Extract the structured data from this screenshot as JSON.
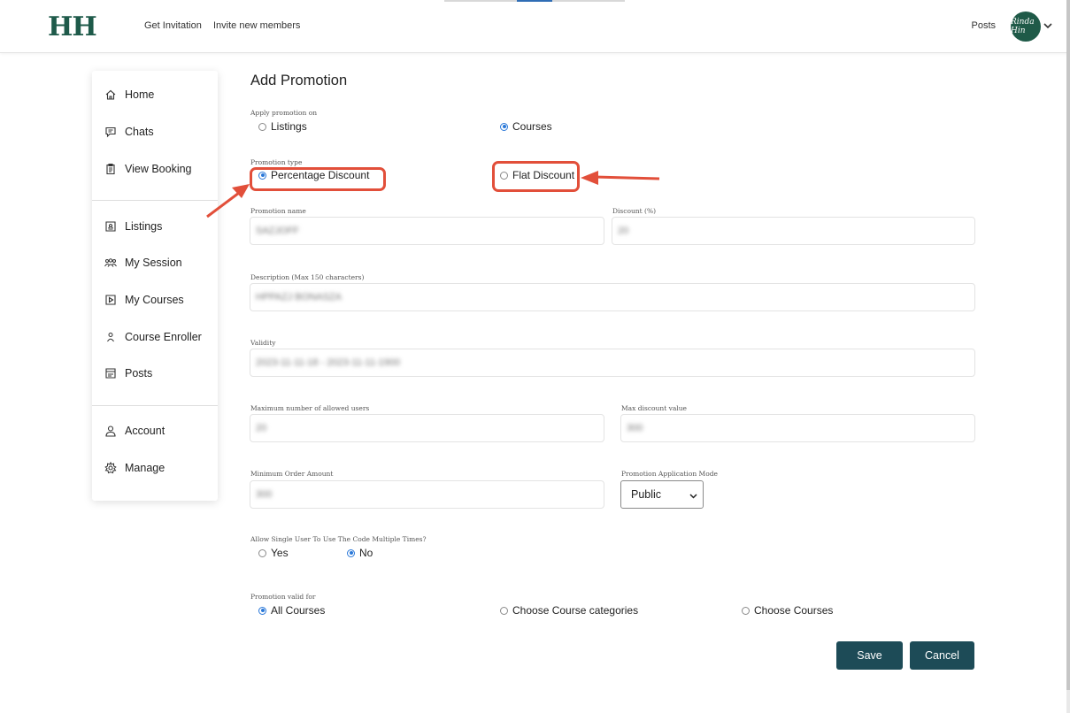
{
  "header": {
    "logo": "HH",
    "nav_links": [
      "Get Invitation",
      "Invite new members"
    ],
    "posts_link": "Posts",
    "avatar_text": "Rinda Hin"
  },
  "sidebar": {
    "items": [
      {
        "label": "Home",
        "icon": "home-icon"
      },
      {
        "label": "Chats",
        "icon": "chat-icon"
      },
      {
        "label": "View Booking",
        "icon": "clipboard-icon"
      },
      {
        "label": "Listings",
        "icon": "listing-icon"
      },
      {
        "label": "My Session",
        "icon": "group-icon"
      },
      {
        "label": "My Courses",
        "icon": "play-icon"
      },
      {
        "label": "Course Enroller",
        "icon": "user-icon"
      },
      {
        "label": "Posts",
        "icon": "posts-icon"
      },
      {
        "label": "Account",
        "icon": "person-icon"
      },
      {
        "label": "Manage",
        "icon": "gear-icon"
      }
    ]
  },
  "form": {
    "title": "Add Promotion",
    "apply_on": {
      "label": "Apply promotion on",
      "options": [
        "Listings",
        "Courses"
      ],
      "selected": "Courses"
    },
    "promotion_type": {
      "label": "Promotion type",
      "options": [
        "Percentage Discount",
        "Flat Discount"
      ],
      "selected": "Percentage Discount"
    },
    "promotion_name": {
      "label": "Promotion name",
      "value": "SAZJOFF"
    },
    "discount": {
      "label": "Discount (%)",
      "value": "20"
    },
    "description": {
      "label": "Description (Max 150 characters)",
      "value": "HPPAZJ BONASZA"
    },
    "validity": {
      "label": "Validity",
      "value": "2023-11-11-18 - 2023-11-11-1900"
    },
    "max_users": {
      "label": "Maximum number of allowed users",
      "value": "20"
    },
    "max_discount": {
      "label": "Max discount value",
      "value": "300"
    },
    "min_order": {
      "label": "Minimum Order Amount",
      "value": "300"
    },
    "application_mode": {
      "label": "Promotion Application Mode",
      "value": "Public"
    },
    "multi_use": {
      "label": "Allow Single User To Use The Code Multiple Times?",
      "options": [
        "Yes",
        "No"
      ],
      "selected": "No"
    },
    "valid_for": {
      "label": "Promotion valid for",
      "options": [
        "All Courses",
        "Choose Course categories",
        "Choose Courses"
      ],
      "selected": "All Courses"
    },
    "save_label": "Save",
    "cancel_label": "Cancel"
  },
  "colors": {
    "brand": "#1e5a4a",
    "button": "#1d4b57",
    "radio_selected": "#2a78d8",
    "annotation": "#e24f3a"
  }
}
